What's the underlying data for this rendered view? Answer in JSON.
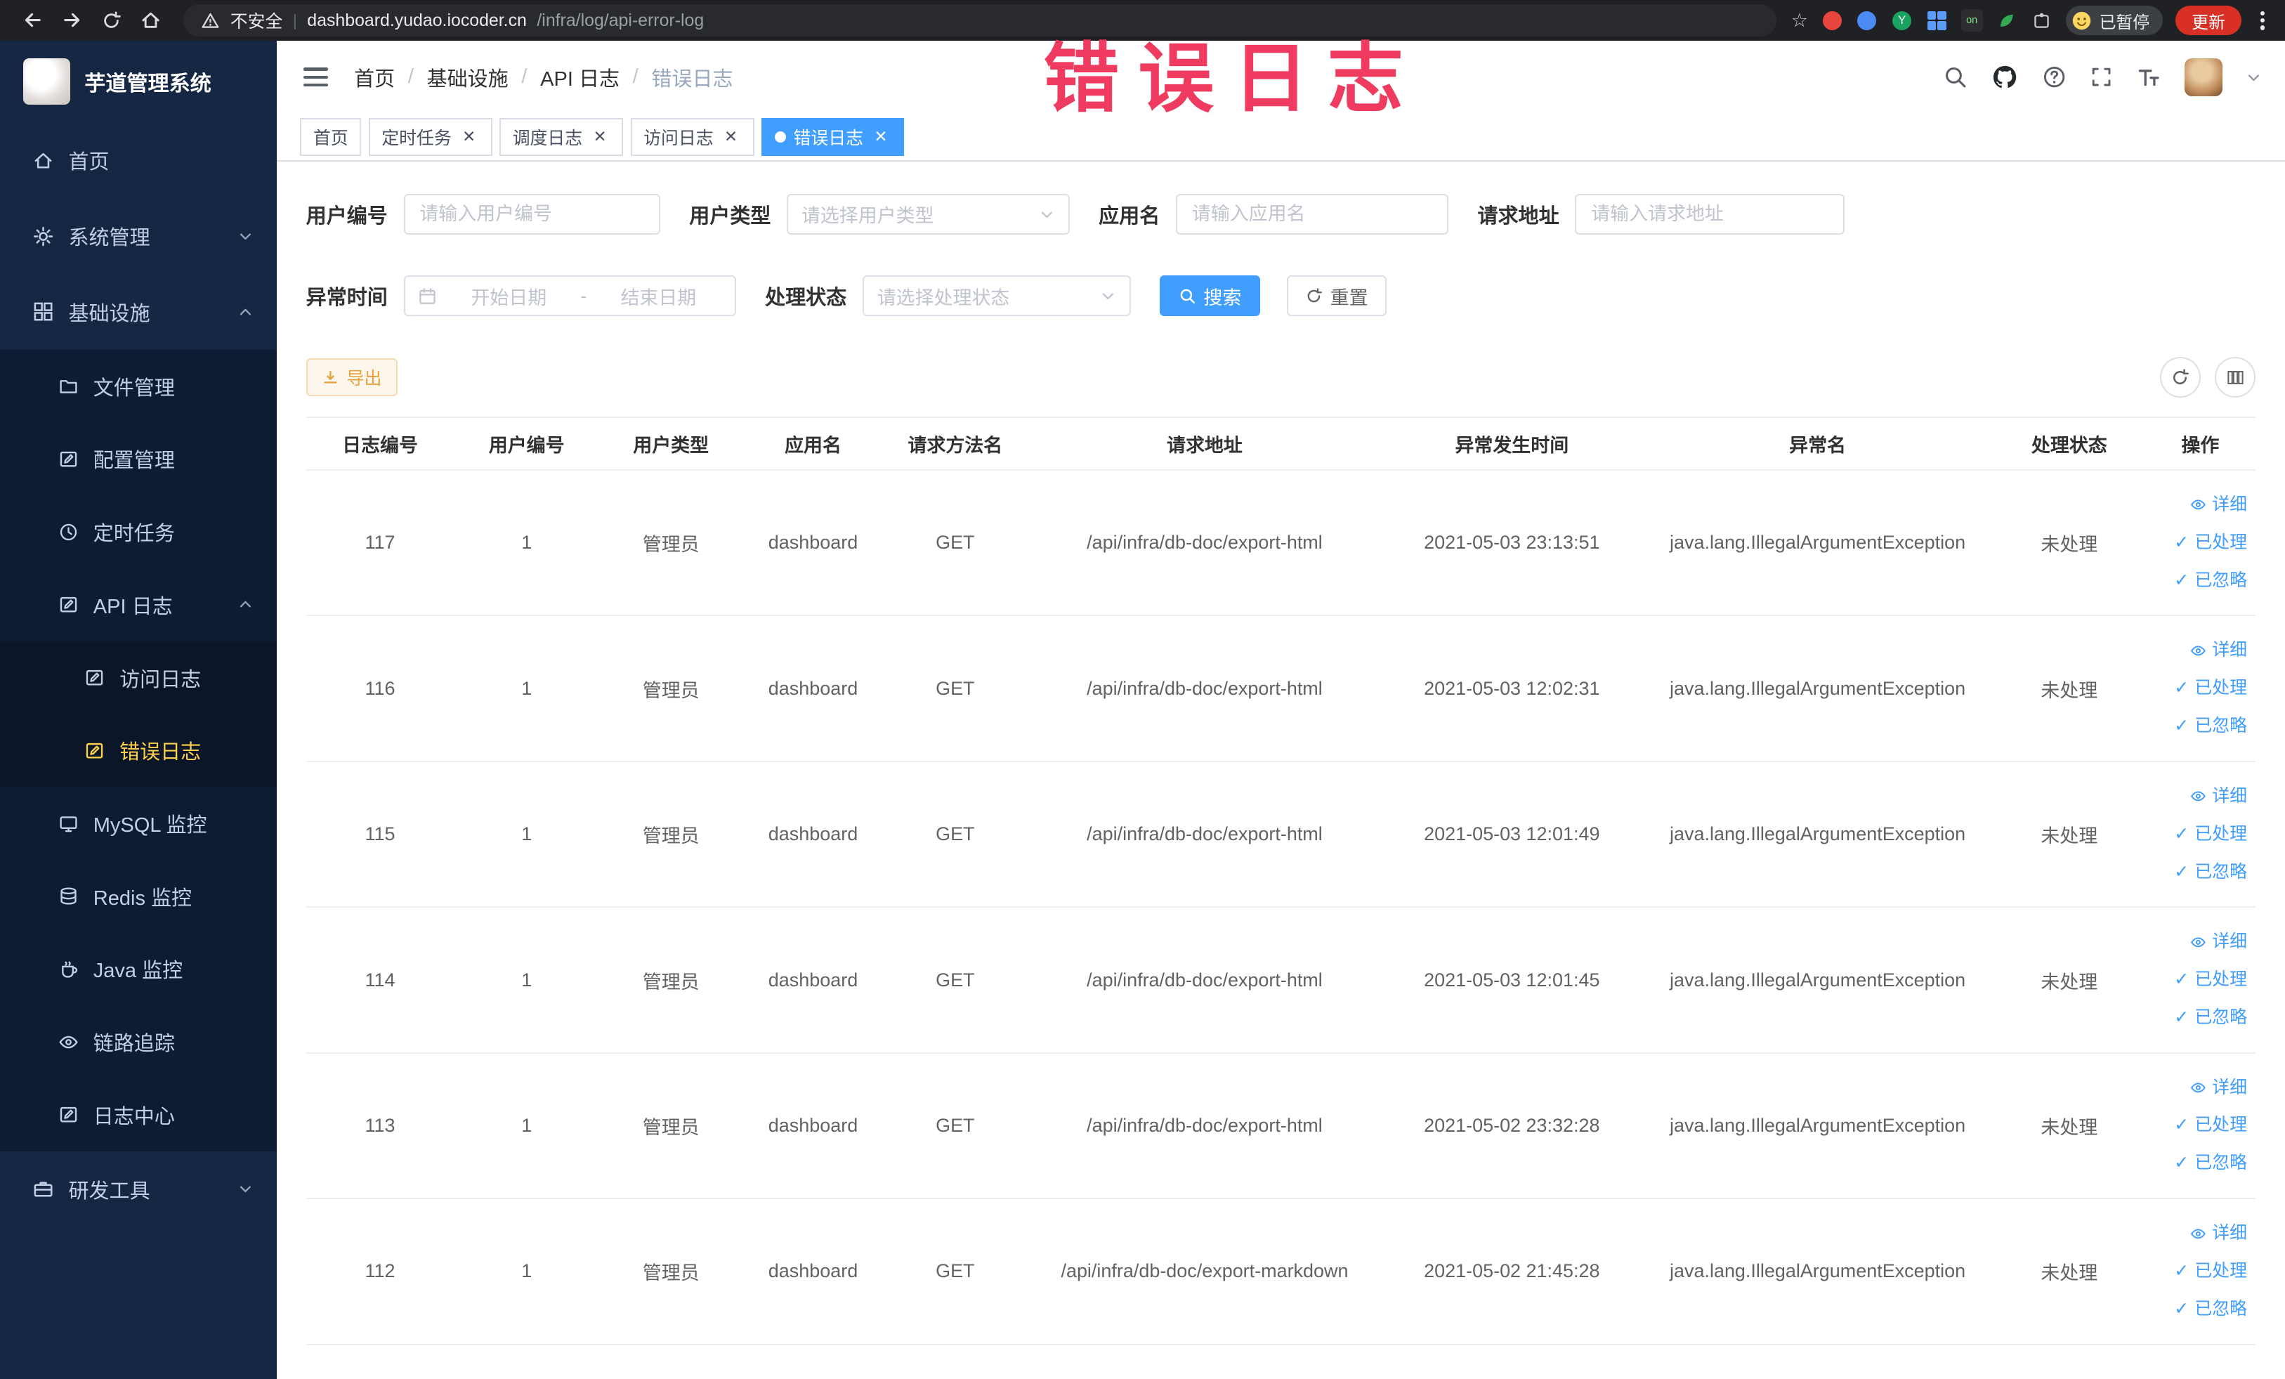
{
  "browser": {
    "security_label": "不安全",
    "url_domain": "dashboard.yudao.iocoder.cn",
    "url_path": "/infra/log/api-error-log",
    "extension_badge": "on",
    "extension_letter": "Y",
    "profile_chip": "已暂停",
    "update_button": "更新"
  },
  "annotation": {
    "text": "错误日志",
    "color": "#ee3b5f"
  },
  "sidebar": {
    "logo_title": "芋道管理系统",
    "menu": [
      {
        "label": "首页"
      },
      {
        "label": "系统管理"
      },
      {
        "label": "基础设施"
      },
      {
        "label": "文件管理"
      },
      {
        "label": "配置管理"
      },
      {
        "label": "定时任务"
      },
      {
        "label": "API 日志"
      },
      {
        "label": "访问日志"
      },
      {
        "label": "错误日志"
      },
      {
        "label": "MySQL 监控"
      },
      {
        "label": "Redis 监控"
      },
      {
        "label": "Java 监控"
      },
      {
        "label": "链路追踪"
      },
      {
        "label": "日志中心"
      },
      {
        "label": "研发工具"
      }
    ]
  },
  "navbar": {
    "breadcrumbs": [
      "首页",
      "基础设施",
      "API 日志",
      "错误日志"
    ]
  },
  "tabs": [
    {
      "label": "首页"
    },
    {
      "label": "定时任务"
    },
    {
      "label": "调度日志"
    },
    {
      "label": "访问日志"
    },
    {
      "label": "错误日志"
    }
  ],
  "filters": {
    "user_id": {
      "label": "用户编号",
      "placeholder": "请输入用户编号"
    },
    "user_type": {
      "label": "用户类型",
      "placeholder": "请选择用户类型"
    },
    "app_name": {
      "label": "应用名",
      "placeholder": "请输入应用名"
    },
    "request_url": {
      "label": "请求地址",
      "placeholder": "请输入请求地址"
    },
    "exception_time": {
      "label": "异常时间",
      "start_placeholder": "开始日期",
      "separator": "-",
      "end_placeholder": "结束日期"
    },
    "process_status": {
      "label": "处理状态",
      "placeholder": "请选择处理状态"
    },
    "search_label": "搜索",
    "reset_label": "重置"
  },
  "toolbar": {
    "export_label": "导出"
  },
  "table": {
    "columns": [
      "日志编号",
      "用户编号",
      "用户类型",
      "应用名",
      "请求方法名",
      "请求地址",
      "异常发生时间",
      "异常名",
      "处理状态",
      "操作"
    ],
    "row_actions": {
      "detail": "详细",
      "processed": "已处理",
      "ignored": "已忽略"
    },
    "rows": [
      {
        "id": "117",
        "user_id": "1",
        "user_type": "管理员",
        "app": "dashboard",
        "method": "GET",
        "url": "/api/infra/db-doc/export-html",
        "time": "2021-05-03 23:13:51",
        "exception": "java.lang.IllegalArgumentException",
        "status": "未处理"
      },
      {
        "id": "116",
        "user_id": "1",
        "user_type": "管理员",
        "app": "dashboard",
        "method": "GET",
        "url": "/api/infra/db-doc/export-html",
        "time": "2021-05-03 12:02:31",
        "exception": "java.lang.IllegalArgumentException",
        "status": "未处理"
      },
      {
        "id": "115",
        "user_id": "1",
        "user_type": "管理员",
        "app": "dashboard",
        "method": "GET",
        "url": "/api/infra/db-doc/export-html",
        "time": "2021-05-03 12:01:49",
        "exception": "java.lang.IllegalArgumentException",
        "status": "未处理"
      },
      {
        "id": "114",
        "user_id": "1",
        "user_type": "管理员",
        "app": "dashboard",
        "method": "GET",
        "url": "/api/infra/db-doc/export-html",
        "time": "2021-05-03 12:01:45",
        "exception": "java.lang.IllegalArgumentException",
        "status": "未处理"
      },
      {
        "id": "113",
        "user_id": "1",
        "user_type": "管理员",
        "app": "dashboard",
        "method": "GET",
        "url": "/api/infra/db-doc/export-html",
        "time": "2021-05-02 23:32:28",
        "exception": "java.lang.IllegalArgumentException",
        "status": "未处理"
      },
      {
        "id": "112",
        "user_id": "1",
        "user_type": "管理员",
        "app": "dashboard",
        "method": "GET",
        "url": "/api/infra/db-doc/export-markdown",
        "time": "2021-05-02 21:45:28",
        "exception": "java.lang.IllegalArgumentException",
        "status": "未处理"
      }
    ]
  },
  "icons": {
    "warning-triangle-icon": "△!",
    "search-icon": "magnifier",
    "github-icon": "octocat",
    "question-icon": "?-circle",
    "fullscreen-icon": "expand-corners",
    "font-size-icon": "TT",
    "download-icon": "arrow-down-line",
    "refresh-icon": "circular-arrow",
    "columns-icon": "vertical-bars",
    "calendar-icon": "calendar",
    "eye-icon": "eye",
    "check-icon": "✓"
  },
  "colors": {
    "accent": "#409EFF",
    "active_menu": "#ffd04b",
    "warning": "#e6a23c",
    "annotation": "#ee3b5f",
    "sidebar_bg": "#152742"
  }
}
